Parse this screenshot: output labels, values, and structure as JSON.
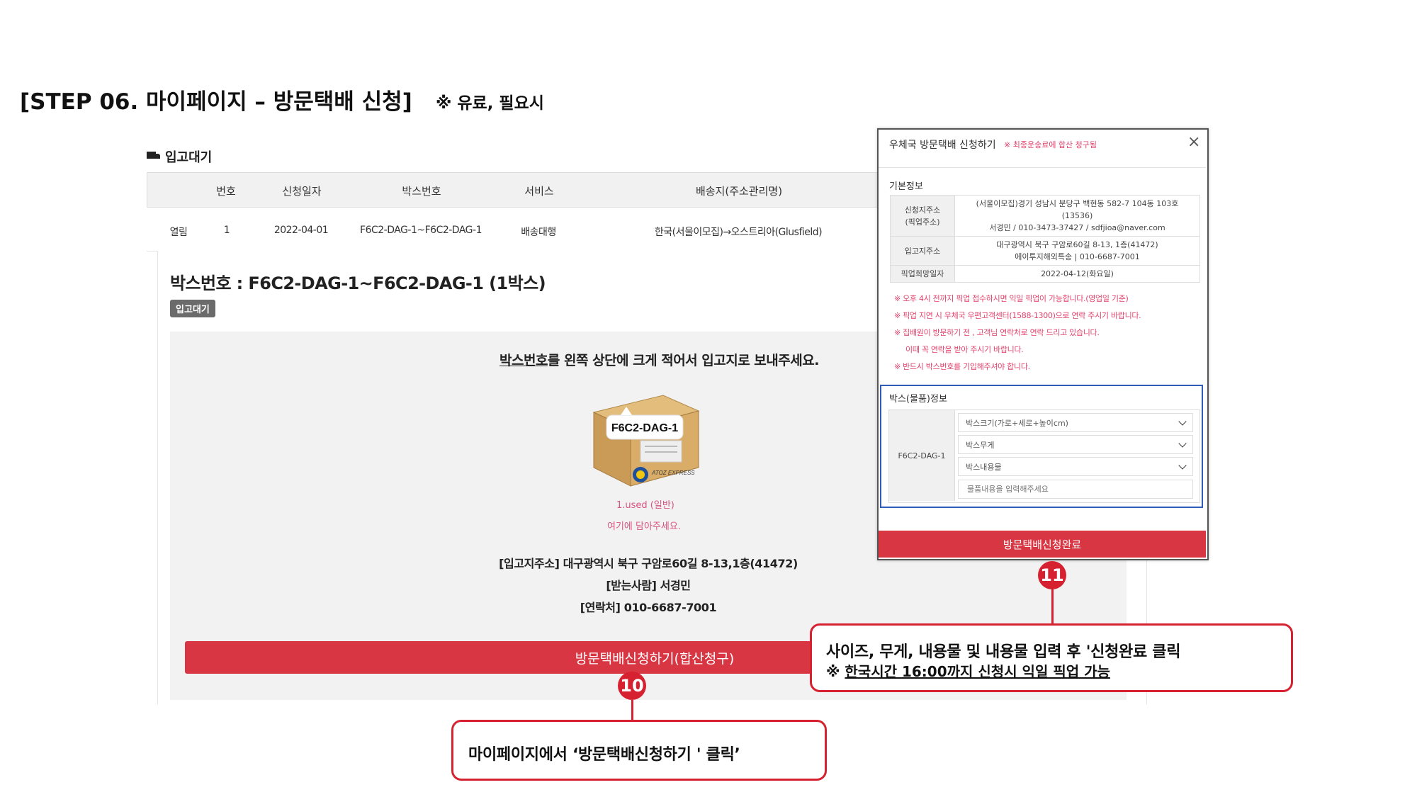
{
  "page": {
    "title": "[STEP 06. 마이페이지 – 방문택배 신청]",
    "subtitle": "※ 유료, 필요시"
  },
  "section": {
    "title": "입고대기"
  },
  "table": {
    "headers": [
      "번호",
      "신청일자",
      "박스번호",
      "서비스",
      "배송지(주소관리명)"
    ],
    "row": {
      "toggle": "열림",
      "number": "1",
      "date": "2022-04-01",
      "box_no": "F6C2-DAG-1~F6C2-DAG-1",
      "service": "배송대행",
      "destination": "한국(서울이모집)→오스트리아(Glusfield)"
    }
  },
  "detail": {
    "box_title": "박스번호 : F6C2-DAG-1~F6C2-DAG-1 (1박스)",
    "status": "입고대기",
    "instruction_emph": "박스번호",
    "instruction_rest": "를 왼쪽 상단에 크게 적어서 입고지로 보내주세요.",
    "box_label": "F6C2-DAG-1",
    "box_brand": "ATOZ EXPRESS",
    "used_line1": "1.used (일반)",
    "used_line2": "여기에 담아주세요.",
    "warehouse_address": "[입고지주소] 대구광역시 북구 구암로60길 8-13,1층(41472)",
    "receiver": "[받는사람] 서경민",
    "contact": "[연락처] 010-6687-7001",
    "visit_button": "방문택배신청하기(합산청구)"
  },
  "modal": {
    "title": "우체국 방문택배 신청하기",
    "title_note": "※ 최종운송료에 합산 청구됨",
    "close": "×",
    "basic_info": "기본정보",
    "rows": [
      {
        "label": "신청지주소\n(픽업주소)",
        "line1": "(서울이모집)경기 성남시 분당구 백현동 582-7 104동 103호",
        "line2": "(13536)",
        "line3": "서경민 / 010-3473-37427 / sdfjioa@naver.com"
      },
      {
        "label": "입고지주소",
        "line1": "대구광역시 북구 구암로60길 8-13, 1층(41472)",
        "line2": "에이투지해외특송 | 010-6687-7001"
      },
      {
        "label": "픽업희망일자",
        "line1": "2022-04-12(화요일)"
      }
    ],
    "notes": [
      "※ 오후 4시 전까지 픽업 접수하시면 익일 픽업이 가능합니다.(영업일 기준)",
      "※ 픽업 지연 시 우체국 우편고객센터(1588-1300)으로 연락 주시기 바랍니다.",
      "※ 집배원이 방문하기 전 , 고객님 연락처로 연락 드리고 있습니다.",
      "이때 꼭 연락을 받아 주시기 바랍니다.",
      "※ 반드시 박스번호를 기입해주셔야 합니다."
    ],
    "box_info": "박스(물품)정보",
    "box_id": "F6C2-DAG-1",
    "select_size": "박스크기(가로+세로+높이cm)",
    "select_weight": "박스무게",
    "select_contents": "박스내용물",
    "contents_placeholder": "물품내용을 입력해주세요",
    "submit": "방문택배신청완료"
  },
  "callouts": {
    "c10": {
      "number": "10",
      "text": "마이페이지에서 ‘방문택배신청하기 ' 클릭’"
    },
    "c11": {
      "number": "11",
      "line1": "사이즈, 무게, 내용물 및 내용물 입력 후 '신청완료 클릭",
      "line2_prefix": "※ ",
      "line2_underlined": "한국시간 16:00까지 신청시 익일 픽업 가능"
    }
  },
  "colors": {
    "accent_red": "#d93644",
    "callout_red": "#d62230",
    "note_pink": "#e2416b",
    "highlight_blue": "#2e5cb8"
  },
  "icons": [
    "truck-icon",
    "close-icon",
    "chevron-down-icon"
  ]
}
